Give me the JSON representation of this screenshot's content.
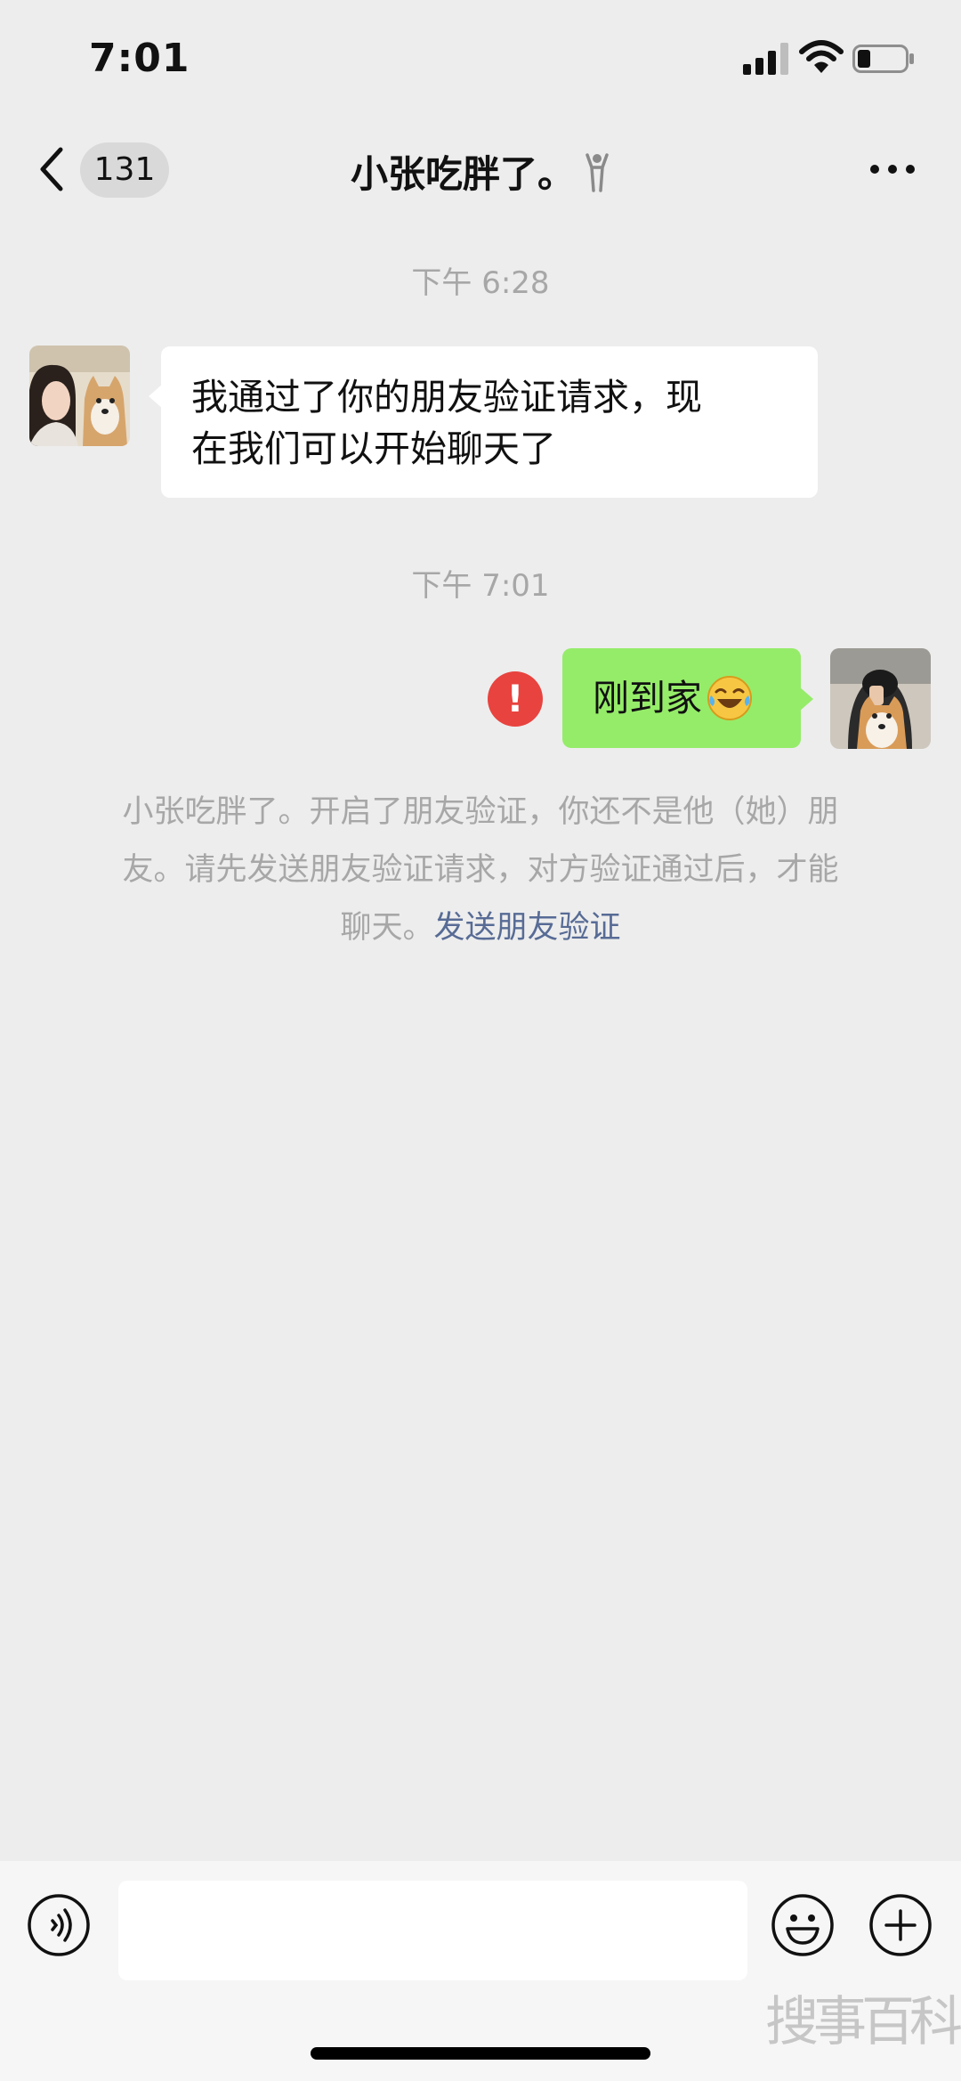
{
  "status_bar": {
    "time": "7:01"
  },
  "nav": {
    "unread_count": "131",
    "title": "小张吃胖了。"
  },
  "messages": {
    "time_1": "下午 6:28",
    "incoming_line1": "我通过了你的朋友验证请求，现",
    "incoming_line2": "在我们可以开始聊天了",
    "time_2": "下午 7:01",
    "outgoing_text": "刚到家",
    "error_mark": "!"
  },
  "notice": {
    "line1": "小张吃胖了。开启了朋友验证，你还不是他（她）朋",
    "line2": "友。请先发送朋友验证请求，对方验证通过后，才能",
    "line3_prefix": "聊天。",
    "link": "发送朋友验证"
  },
  "watermark": "搜事百科",
  "colors": {
    "outgoing_bubble": "#95ec69",
    "link": "#576b95",
    "error": "#e8433f",
    "background": "#ededed"
  },
  "icons": [
    "back-chevron-icon",
    "more-dots-icon",
    "voice-icon",
    "emoji-icon",
    "plus-icon",
    "signal-icon",
    "wifi-icon",
    "battery-icon"
  ]
}
